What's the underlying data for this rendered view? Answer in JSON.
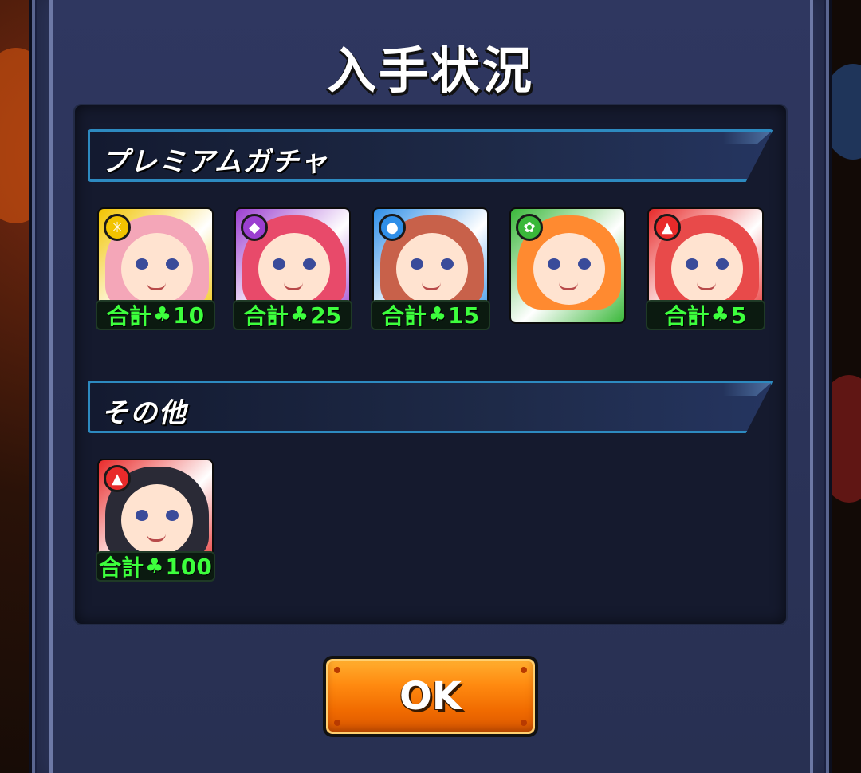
{
  "dialog": {
    "title": "入手状況",
    "ok_label": "OK"
  },
  "sections": [
    {
      "label": "プレミアムガチャ",
      "items": [
        {
          "badge_prefix": "合計",
          "badge_value": "10",
          "element": "light-icon",
          "frame_color": "#f2c400",
          "hair_color": "#f4a6b8"
        },
        {
          "badge_prefix": "合計",
          "badge_value": "25",
          "element": "dark-icon",
          "frame_color": "#9b3fd0",
          "hair_color": "#e84a6a"
        },
        {
          "badge_prefix": "合計",
          "badge_value": "15",
          "element": "water-icon",
          "frame_color": "#2f8fe8",
          "hair_color": "#c8614a"
        },
        {
          "badge_prefix": "",
          "badge_value": "",
          "element": "wood-icon",
          "frame_color": "#3ab83a",
          "hair_color": "#ff8a30"
        },
        {
          "badge_prefix": "合計",
          "badge_value": "5",
          "element": "fire-icon",
          "frame_color": "#e82a2a",
          "hair_color": "#e84a4a"
        }
      ]
    },
    {
      "label": "その他",
      "items": [
        {
          "badge_prefix": "合計",
          "badge_value": "100",
          "element": "fire-icon",
          "frame_color": "#e82a2a",
          "hair_color": "#2a2a36"
        }
      ]
    }
  ],
  "icons": {
    "clover": "♣",
    "light-icon": "✳",
    "dark-icon": "◆",
    "water-icon": "●",
    "wood-icon": "✿",
    "fire-icon": "▲"
  }
}
